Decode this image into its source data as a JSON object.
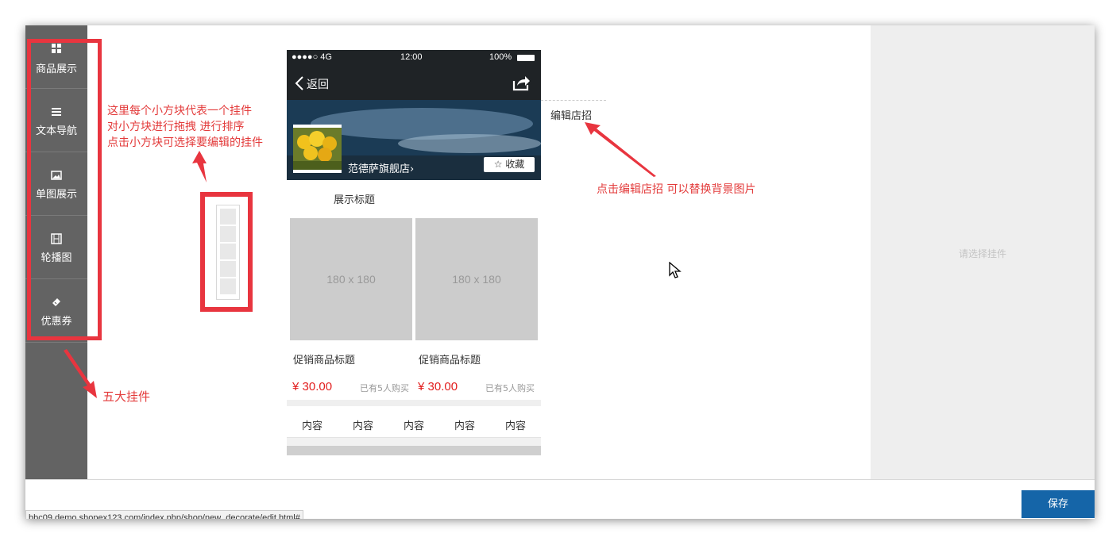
{
  "sidebar": {
    "items": [
      {
        "label": "商品展示",
        "icon": "grid-icon"
      },
      {
        "label": "文本导航",
        "icon": "list-icon"
      },
      {
        "label": "单图展示",
        "icon": "image-icon"
      },
      {
        "label": "轮播图",
        "icon": "film-icon"
      },
      {
        "label": "优惠券",
        "icon": "ticket-icon"
      }
    ]
  },
  "annotations": {
    "widgets_note_lines": [
      "这里每个小方块代表一个挂件",
      "对小方块进行拖拽 进行排序",
      "点击小方块可选择要编辑的挂件"
    ],
    "five_widgets": "五大挂件",
    "edit_sign_note": "点击编辑店招  可以替换背景图片"
  },
  "phone": {
    "status": {
      "signal": "●●●●○ 4G",
      "time": "12:00",
      "battery": "100%"
    },
    "nav": {
      "back": "返回"
    },
    "banner": {
      "shop_name": "范德萨旗舰店›",
      "favorite": "☆ 收藏"
    },
    "section_title": "展示标题",
    "products": [
      {
        "image_text": "180 x 180",
        "title": "促销商品标题",
        "price": "¥ 30.00",
        "sold": "已有5人购买"
      },
      {
        "image_text": "180 x 180",
        "title": "促销商品标题",
        "price": "¥ 30.00",
        "sold": "已有5人购买"
      }
    ],
    "nav_items": [
      "内容",
      "内容",
      "内容",
      "内容",
      "内容"
    ]
  },
  "edit_sign_label": "编辑店招",
  "right_panel": {
    "placeholder": "请选择挂件"
  },
  "footer": {
    "save_label": "保存"
  },
  "status_url": "bbc09.demo.shopex123.com/index.php/shop/new_decorate/edit.html#",
  "colors": {
    "sidebar": "#636363",
    "annotation_red": "#e33b3b",
    "save_button": "#1565a8",
    "price": "#e21d1d"
  }
}
